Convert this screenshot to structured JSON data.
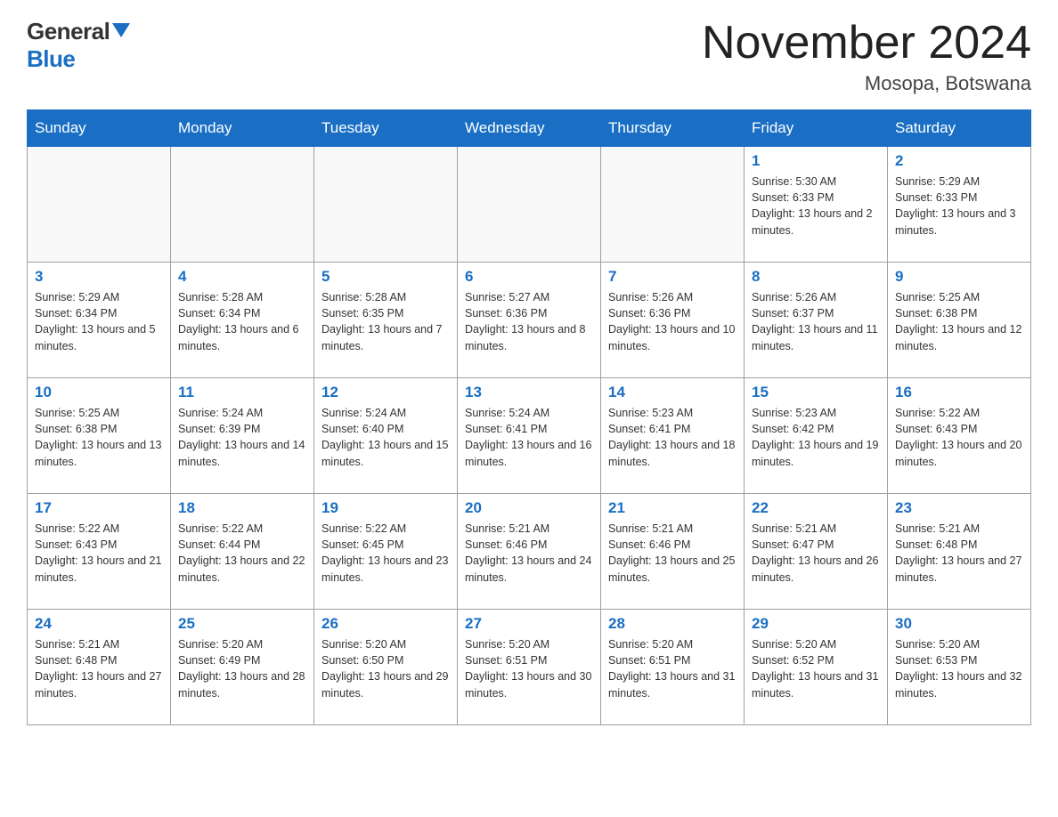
{
  "logo": {
    "general": "General",
    "blue": "Blue"
  },
  "title": {
    "month": "November 2024",
    "location": "Mosopa, Botswana"
  },
  "weekdays": [
    "Sunday",
    "Monday",
    "Tuesday",
    "Wednesday",
    "Thursday",
    "Friday",
    "Saturday"
  ],
  "weeks": [
    [
      {
        "day": "",
        "info": ""
      },
      {
        "day": "",
        "info": ""
      },
      {
        "day": "",
        "info": ""
      },
      {
        "day": "",
        "info": ""
      },
      {
        "day": "",
        "info": ""
      },
      {
        "day": "1",
        "info": "Sunrise: 5:30 AM\nSunset: 6:33 PM\nDaylight: 13 hours and 2 minutes."
      },
      {
        "day": "2",
        "info": "Sunrise: 5:29 AM\nSunset: 6:33 PM\nDaylight: 13 hours and 3 minutes."
      }
    ],
    [
      {
        "day": "3",
        "info": "Sunrise: 5:29 AM\nSunset: 6:34 PM\nDaylight: 13 hours and 5 minutes."
      },
      {
        "day": "4",
        "info": "Sunrise: 5:28 AM\nSunset: 6:34 PM\nDaylight: 13 hours and 6 minutes."
      },
      {
        "day": "5",
        "info": "Sunrise: 5:28 AM\nSunset: 6:35 PM\nDaylight: 13 hours and 7 minutes."
      },
      {
        "day": "6",
        "info": "Sunrise: 5:27 AM\nSunset: 6:36 PM\nDaylight: 13 hours and 8 minutes."
      },
      {
        "day": "7",
        "info": "Sunrise: 5:26 AM\nSunset: 6:36 PM\nDaylight: 13 hours and 10 minutes."
      },
      {
        "day": "8",
        "info": "Sunrise: 5:26 AM\nSunset: 6:37 PM\nDaylight: 13 hours and 11 minutes."
      },
      {
        "day": "9",
        "info": "Sunrise: 5:25 AM\nSunset: 6:38 PM\nDaylight: 13 hours and 12 minutes."
      }
    ],
    [
      {
        "day": "10",
        "info": "Sunrise: 5:25 AM\nSunset: 6:38 PM\nDaylight: 13 hours and 13 minutes."
      },
      {
        "day": "11",
        "info": "Sunrise: 5:24 AM\nSunset: 6:39 PM\nDaylight: 13 hours and 14 minutes."
      },
      {
        "day": "12",
        "info": "Sunrise: 5:24 AM\nSunset: 6:40 PM\nDaylight: 13 hours and 15 minutes."
      },
      {
        "day": "13",
        "info": "Sunrise: 5:24 AM\nSunset: 6:41 PM\nDaylight: 13 hours and 16 minutes."
      },
      {
        "day": "14",
        "info": "Sunrise: 5:23 AM\nSunset: 6:41 PM\nDaylight: 13 hours and 18 minutes."
      },
      {
        "day": "15",
        "info": "Sunrise: 5:23 AM\nSunset: 6:42 PM\nDaylight: 13 hours and 19 minutes."
      },
      {
        "day": "16",
        "info": "Sunrise: 5:22 AM\nSunset: 6:43 PM\nDaylight: 13 hours and 20 minutes."
      }
    ],
    [
      {
        "day": "17",
        "info": "Sunrise: 5:22 AM\nSunset: 6:43 PM\nDaylight: 13 hours and 21 minutes."
      },
      {
        "day": "18",
        "info": "Sunrise: 5:22 AM\nSunset: 6:44 PM\nDaylight: 13 hours and 22 minutes."
      },
      {
        "day": "19",
        "info": "Sunrise: 5:22 AM\nSunset: 6:45 PM\nDaylight: 13 hours and 23 minutes."
      },
      {
        "day": "20",
        "info": "Sunrise: 5:21 AM\nSunset: 6:46 PM\nDaylight: 13 hours and 24 minutes."
      },
      {
        "day": "21",
        "info": "Sunrise: 5:21 AM\nSunset: 6:46 PM\nDaylight: 13 hours and 25 minutes."
      },
      {
        "day": "22",
        "info": "Sunrise: 5:21 AM\nSunset: 6:47 PM\nDaylight: 13 hours and 26 minutes."
      },
      {
        "day": "23",
        "info": "Sunrise: 5:21 AM\nSunset: 6:48 PM\nDaylight: 13 hours and 27 minutes."
      }
    ],
    [
      {
        "day": "24",
        "info": "Sunrise: 5:21 AM\nSunset: 6:48 PM\nDaylight: 13 hours and 27 minutes."
      },
      {
        "day": "25",
        "info": "Sunrise: 5:20 AM\nSunset: 6:49 PM\nDaylight: 13 hours and 28 minutes."
      },
      {
        "day": "26",
        "info": "Sunrise: 5:20 AM\nSunset: 6:50 PM\nDaylight: 13 hours and 29 minutes."
      },
      {
        "day": "27",
        "info": "Sunrise: 5:20 AM\nSunset: 6:51 PM\nDaylight: 13 hours and 30 minutes."
      },
      {
        "day": "28",
        "info": "Sunrise: 5:20 AM\nSunset: 6:51 PM\nDaylight: 13 hours and 31 minutes."
      },
      {
        "day": "29",
        "info": "Sunrise: 5:20 AM\nSunset: 6:52 PM\nDaylight: 13 hours and 31 minutes."
      },
      {
        "day": "30",
        "info": "Sunrise: 5:20 AM\nSunset: 6:53 PM\nDaylight: 13 hours and 32 minutes."
      }
    ]
  ]
}
